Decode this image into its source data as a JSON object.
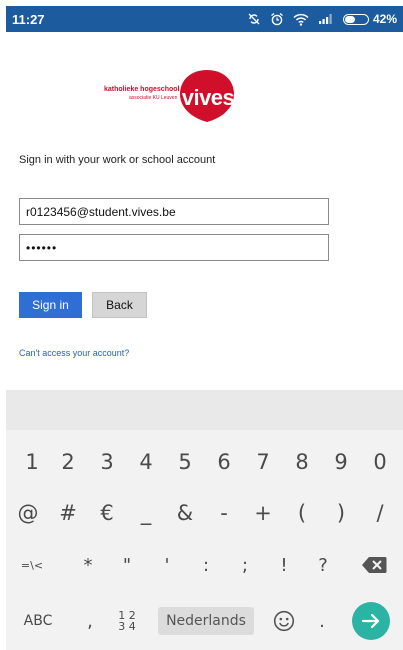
{
  "status_bar": {
    "time": "11:27",
    "battery_percent": "42%",
    "icons": [
      "rotation-off-icon",
      "alarm-icon",
      "wifi-icon",
      "signal-icon",
      "battery-icon"
    ],
    "background_color": "#1c5b9e"
  },
  "logo": {
    "line1": "katholieke hogeschool",
    "line2": "associatie KU Leuven",
    "wordmark": "vives",
    "brand_color": "#c8102e"
  },
  "signin": {
    "heading": "Sign in with your work or school account",
    "email_value": "r0123456@student.vives.be",
    "password_value": "••••••",
    "signin_label": "Sign in",
    "back_label": "Back",
    "cant_access_label": "Can't access your account?",
    "accent_color": "#2f6fd5"
  },
  "keyboard": {
    "row1": [
      "1",
      "2",
      "3",
      "4",
      "5",
      "6",
      "7",
      "8",
      "9",
      "0"
    ],
    "row2": [
      "@",
      "#",
      "€",
      "_",
      "&",
      "-",
      "+",
      "(",
      ")",
      "/"
    ],
    "row3": [
      "=\\<",
      "*",
      "\"",
      "'",
      ":",
      ";",
      "!",
      "?"
    ],
    "abc_label": "ABC",
    "comma": ",",
    "frac_top": "1 2",
    "frac_bottom": "3 4",
    "space_label": "Nederlands",
    "period": ".",
    "enter_color": "#2bb3a3"
  }
}
